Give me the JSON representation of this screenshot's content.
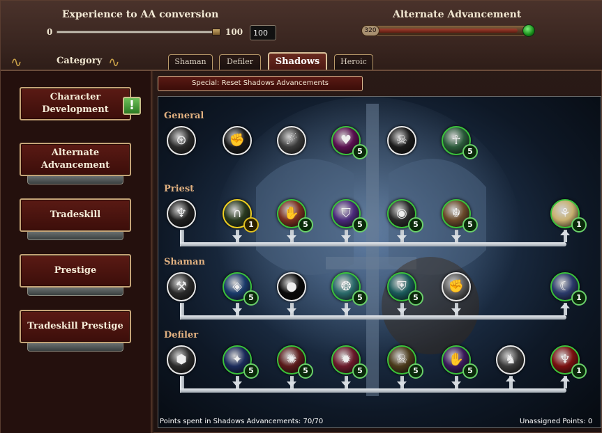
{
  "conversion": {
    "title": "Experience to AA conversion",
    "min": "0",
    "max": "100",
    "value": "100",
    "slider_fraction": 1.0
  },
  "advancement": {
    "title": "Alternate Advancement",
    "points": "320",
    "bar_fraction": 0.92
  },
  "category": {
    "label": "Category"
  },
  "tabs": [
    {
      "label": "Shaman"
    },
    {
      "label": "Defiler"
    },
    {
      "label": "Shadows"
    },
    {
      "label": "Heroic"
    }
  ],
  "sidebar": {
    "items": [
      {
        "label": "Character Development"
      },
      {
        "label": "Alternate Advancement"
      },
      {
        "label": "Tradeskill"
      },
      {
        "label": "Prestige"
      },
      {
        "label": "Tradeskill Prestige"
      }
    ],
    "alert": "!"
  },
  "reset_button": "Special: Reset Shadows Advancements",
  "rows": [
    {
      "label": "General"
    },
    {
      "label": "Priest"
    },
    {
      "label": "Shaman"
    },
    {
      "label": "Defiler"
    }
  ],
  "nodes": {
    "general": [
      {
        "icon": "rune-icon",
        "glyph": "⊛",
        "bg": "#2a2a2a",
        "badge": ""
      },
      {
        "icon": "fist-icon",
        "glyph": "✊",
        "bg": "#1a1a1a",
        "badge": ""
      },
      {
        "icon": "foot-icon",
        "glyph": "☄",
        "bg": "#3a3a3a",
        "badge": ""
      },
      {
        "icon": "heart-icon",
        "glyph": "♥",
        "bg": "#5a1050",
        "badge": "5"
      },
      {
        "icon": "wolf-icon",
        "glyph": "☠",
        "bg": "#1a1a1a",
        "badge": ""
      },
      {
        "icon": "meditation-icon",
        "glyph": "☥",
        "bg": "#2a5a3a",
        "badge": "5"
      }
    ],
    "priest": [
      {
        "icon": "priest-figure-icon",
        "glyph": "♆",
        "bg": "#202020",
        "badge": ""
      },
      {
        "icon": "doorway-icon",
        "glyph": "∩",
        "bg": "#2a3a20",
        "badge": "1"
      },
      {
        "icon": "hand-icon",
        "glyph": "✋",
        "bg": "#7a3020",
        "badge": "5"
      },
      {
        "icon": "shield-icon",
        "glyph": "⛉",
        "bg": "#4a2a7a",
        "badge": "5"
      },
      {
        "icon": "eye-icon",
        "glyph": "◉",
        "bg": "#2a2a2a",
        "badge": "5"
      },
      {
        "icon": "idol-icon",
        "glyph": "☬",
        "bg": "#6a4a2a",
        "badge": "5"
      },
      {
        "icon": "wings-icon",
        "glyph": "⚘",
        "bg": "#c8b070",
        "badge": "1"
      }
    ],
    "shaman": [
      {
        "icon": "totem-icon",
        "glyph": "⚒",
        "bg": "#2a2a2a",
        "badge": ""
      },
      {
        "icon": "spirit-eye-icon",
        "glyph": "◈",
        "bg": "#1a3a6a",
        "badge": "5"
      },
      {
        "icon": "orb-icon",
        "glyph": "●",
        "bg": "#0a0a0a",
        "badge": ""
      },
      {
        "icon": "mask-icon",
        "glyph": "❂",
        "bg": "#2a6a6a",
        "badge": "5"
      },
      {
        "icon": "ward-icon",
        "glyph": "⛨",
        "bg": "#1a5a5a",
        "badge": "5"
      },
      {
        "icon": "gauntlet-icon",
        "glyph": "✊",
        "bg": "#5a5a5a",
        "badge": ""
      },
      {
        "icon": "wolf-howl-icon",
        "glyph": "☾",
        "bg": "#2a3a6a",
        "badge": "1"
      }
    ],
    "defiler": [
      {
        "icon": "stone-icon",
        "glyph": "⬢",
        "bg": "#2a2a2a",
        "badge": ""
      },
      {
        "icon": "wraith-icon",
        "glyph": "✦",
        "bg": "#1a2a5a",
        "badge": "5"
      },
      {
        "icon": "spider-icon",
        "glyph": "✺",
        "bg": "#5a1a1a",
        "badge": "5"
      },
      {
        "icon": "blood-spray-icon",
        "glyph": "✹",
        "bg": "#6a1a2a",
        "badge": "5"
      },
      {
        "icon": "skull-icon",
        "glyph": "☠",
        "bg": "#4a3a1a",
        "badge": "5"
      },
      {
        "icon": "curse-hand-icon",
        "glyph": "✋",
        "bg": "#3a1a5a",
        "badge": "5"
      },
      {
        "icon": "beast-icon",
        "glyph": "♞",
        "bg": "#3a3a3a",
        "badge": ""
      },
      {
        "icon": "demon-icon",
        "glyph": "♆",
        "bg": "#7a1010",
        "badge": "1"
      }
    ]
  },
  "footer": {
    "spent": "Points spent in Shadows Advancements: 70/70",
    "unassigned": "Unassigned Points: 0"
  }
}
